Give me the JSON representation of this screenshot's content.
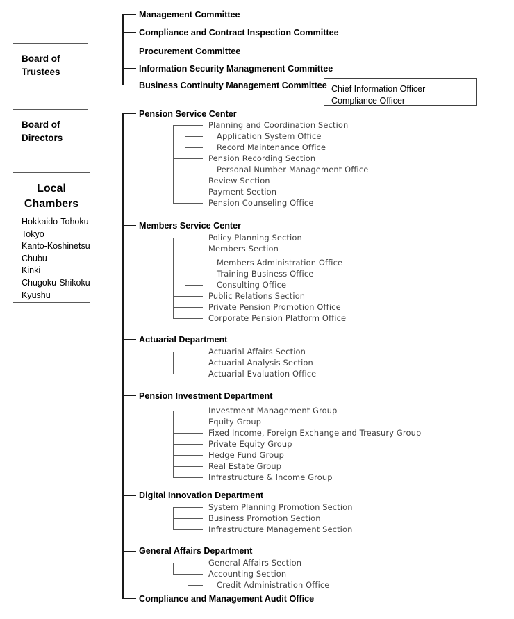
{
  "boards": [
    {
      "id": "board-of-trustees",
      "lines": [
        "Board of",
        "Trustees"
      ]
    },
    {
      "id": "board-of-directors",
      "lines": [
        "Board of",
        "Directors"
      ]
    }
  ],
  "local_chambers": {
    "title_lines": [
      "Local",
      "Chambers"
    ],
    "items": [
      "Hokkaido-Tohoku",
      "Tokyo",
      "Kanto-Koshinetsu",
      "Chubu",
      "Kinki",
      "Chugoku-Shikoku",
      "Kyushu"
    ]
  },
  "officer_box": {
    "lines": [
      "Chief Information Officer",
      "Compliance Officer"
    ]
  },
  "committees": [
    "Management Committee",
    "Compliance and Contract Inspection Committee",
    "Procurement Committee",
    "Information Security Managmenent Committee",
    "Business Continuity Management Committee"
  ],
  "departments": [
    {
      "name": "Pension Service Center",
      "children": [
        {
          "name": "Planning and Coordination Section",
          "children": [
            "Application System Office",
            "Record Maintenance Office"
          ]
        },
        {
          "name": "Pension Recording Section",
          "children": [
            "Personal Number Management Office"
          ]
        },
        {
          "name": "Review Section",
          "children": []
        },
        {
          "name": "Payment Section",
          "children": []
        },
        {
          "name": "Pension Counseling Office",
          "children": []
        }
      ]
    },
    {
      "name": "Members Service Center",
      "children": [
        {
          "name": "Policy Planning Section",
          "children": []
        },
        {
          "name": "Members Section",
          "children": [
            "Members Administration Office",
            "Training Business Office",
            "Consulting Office"
          ]
        },
        {
          "name": "Public Relations Section",
          "children": []
        },
        {
          "name": "Private Pension Promotion Office",
          "children": []
        },
        {
          "name": "Corporate Pension Platform Office",
          "children": []
        }
      ]
    },
    {
      "name": "Actuarial Department",
      "children": [
        {
          "name": "Actuarial Affairs Section",
          "children": []
        },
        {
          "name": "Actuarial Analysis Section",
          "children": []
        },
        {
          "name": "Actuarial Evaluation Office",
          "children": []
        }
      ]
    },
    {
      "name": "Pension Investment Department",
      "children": [
        {
          "name": "Investment Management Group",
          "children": []
        },
        {
          "name": "Equity Group",
          "children": []
        },
        {
          "name": "Fixed Income, Foreign Exchange and Treasury Group",
          "children": []
        },
        {
          "name": "Private Equity Group",
          "children": []
        },
        {
          "name": "Hedge Fund Group",
          "children": []
        },
        {
          "name": "Real Estate Group",
          "children": []
        },
        {
          "name": "Infrastructure & Income Group",
          "children": []
        }
      ]
    },
    {
      "name": "Digital Innovation Department",
      "children": [
        {
          "name": "System Planning Promotion Section",
          "children": []
        },
        {
          "name": "Business Promotion Section",
          "children": []
        },
        {
          "name": "Infrastructure Management Section",
          "children": []
        }
      ]
    },
    {
      "name": "General Affairs Department",
      "children": [
        {
          "name": "General Affairs Section",
          "children": []
        },
        {
          "name": "Accounting Section",
          "children": [
            "Credit Administration Office"
          ]
        }
      ]
    },
    {
      "name": "Compliance and Management Audit Office",
      "children": []
    }
  ],
  "colors": {
    "line": "#1a1a1a",
    "sub_line": "#595959",
    "box_border": "#595959",
    "text": "#000000",
    "sub_text": "#404040"
  }
}
